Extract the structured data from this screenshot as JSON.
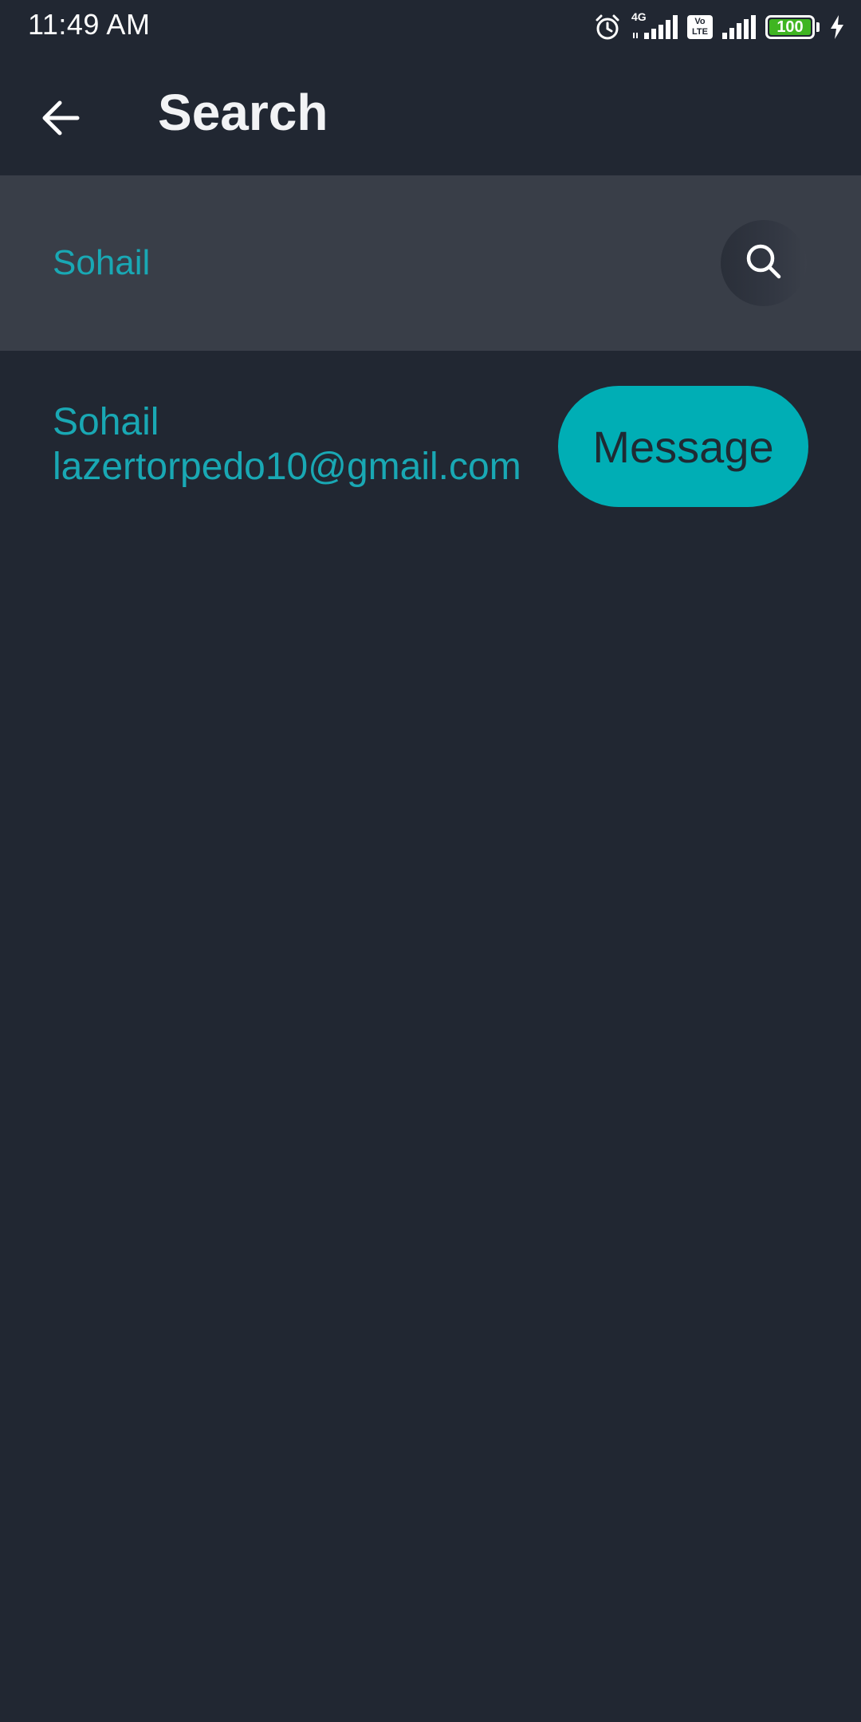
{
  "status_bar": {
    "time": "11:49 AM",
    "network_label": "4G",
    "volte_label_top": "Vo",
    "volte_label_bottom": "LTE",
    "battery_level": "100",
    "battery_color": "#3fb521",
    "icons": [
      "alarm-icon",
      "signal-icon",
      "volte-icon",
      "signal-icon",
      "battery-icon",
      "charging-icon"
    ]
  },
  "app_bar": {
    "back_icon": "arrow-left-icon",
    "title": "Search"
  },
  "search": {
    "value": "Sohail",
    "icon": "search-icon"
  },
  "results": [
    {
      "name": "Sohail",
      "email": "lazertorpedo10@gmail.com",
      "action_label": "Message"
    }
  ],
  "colors": {
    "background": "#212732",
    "search_bar": "#393e48",
    "accent": "#19a8b4",
    "button": "#00aeb5",
    "title": "#f2f3f5"
  }
}
